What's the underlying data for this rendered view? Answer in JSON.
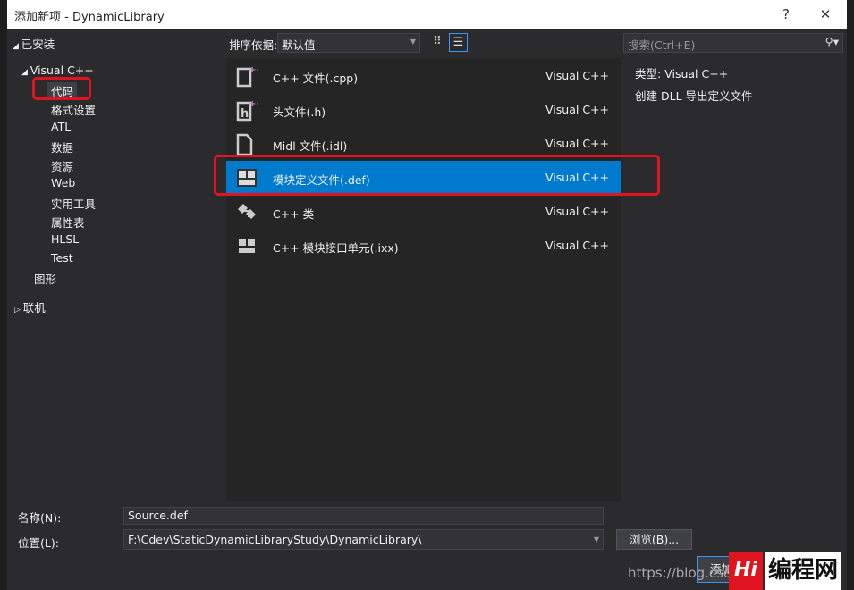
{
  "window": {
    "title": "添加新项 - DynamicLibrary",
    "help": "?",
    "close": "✕"
  },
  "tree": {
    "installed": "已安装",
    "visual_cpp": "Visual C++",
    "children": [
      "代码",
      "格式设置",
      "ATL",
      "数据",
      "资源",
      "Web",
      "实用工具",
      "属性表",
      "HLSL",
      "Test"
    ],
    "graphics": "图形",
    "online": "联机"
  },
  "toolbar": {
    "sort_label": "排序依据:",
    "sort_value": "默认值",
    "search_placeholder": "搜索(Ctrl+E)"
  },
  "templates": [
    {
      "name": "C++ 文件(.cpp)",
      "lang": "Visual C++",
      "icon": "cpp-file-icon"
    },
    {
      "name": "头文件(.h)",
      "lang": "Visual C++",
      "icon": "header-file-icon"
    },
    {
      "name": "Midl 文件(.idl)",
      "lang": "Visual C++",
      "icon": "midl-file-icon"
    },
    {
      "name": "模块定义文件(.def)",
      "lang": "Visual C++",
      "icon": "module-def-icon",
      "selected": true
    },
    {
      "name": "C++ 类",
      "lang": "Visual C++",
      "icon": "cpp-class-icon"
    },
    {
      "name": "C++ 模块接口单元(.ixx)",
      "lang": "Visual C++",
      "icon": "module-interface-icon"
    }
  ],
  "details": {
    "type_label": "类型:",
    "type_value": "Visual C++",
    "description": "创建 DLL 导出定义文件"
  },
  "form": {
    "name_label": "名称(N):",
    "name_value": "Source.def",
    "location_label": "位置(L):",
    "location_value": "F:\\Cdev\\StaticDynamicLibraryStudy\\DynamicLibrary\\",
    "browse": "浏览(B)...",
    "add": "添加"
  },
  "watermark": {
    "url": "https://blog.csdn",
    "logo": "编程网"
  },
  "colors": {
    "accent": "#007acc",
    "highlight": "#e0141e"
  }
}
